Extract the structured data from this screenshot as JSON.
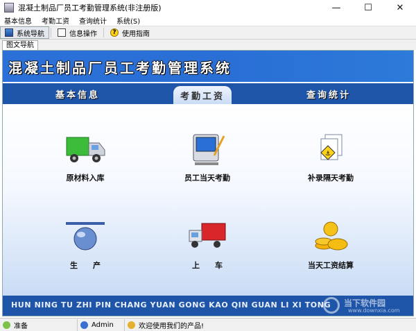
{
  "window": {
    "title": "混凝土制品厂员工考勤管理系统(非注册版)"
  },
  "menu": [
    "基本信息",
    "考勤工资",
    "查询统计",
    "系统(S)"
  ],
  "toolbar": [
    {
      "label": "系统导航",
      "icon": "monitor-icon",
      "active": true
    },
    {
      "label": "信息操作",
      "icon": "document-icon",
      "active": false
    },
    {
      "label": "使用指南",
      "icon": "help-icon",
      "active": false
    }
  ],
  "doc_tab": "图文导航",
  "banner": {
    "title": "混凝土制品厂员工考勤管理系统"
  },
  "tabs": [
    "基本信息",
    "考勤工资",
    "查询统计"
  ],
  "active_tab": "考勤工资",
  "items": [
    {
      "label": "原材料入库",
      "icon": "truck-green-icon"
    },
    {
      "label": "员工当天考勤",
      "icon": "computer-icon"
    },
    {
      "label": "补录隔天考勤",
      "icon": "documents-sign-icon"
    },
    {
      "label": "生　　产",
      "icon": "pipe-icon"
    },
    {
      "label": "上　　车",
      "icon": "truck-red-icon"
    },
    {
      "label": "当天工资结算",
      "icon": "gold-coins-icon"
    }
  ],
  "footer": {
    "pinyin": "HUN NING TU ZHI PIN CHANG YUAN GONG KAO QIN GUAN LI XI TONG"
  },
  "watermark": {
    "text": "当下软件园",
    "url": "www.downxia.com"
  },
  "status": [
    {
      "label": "准备"
    },
    {
      "label": "Admin"
    },
    {
      "label": "欢迎使用我们的产品!"
    }
  ],
  "colors": {
    "banner": "#2a70d8",
    "tabbar": "#1e55a8",
    "content_bottom": "#c9dcf5"
  }
}
